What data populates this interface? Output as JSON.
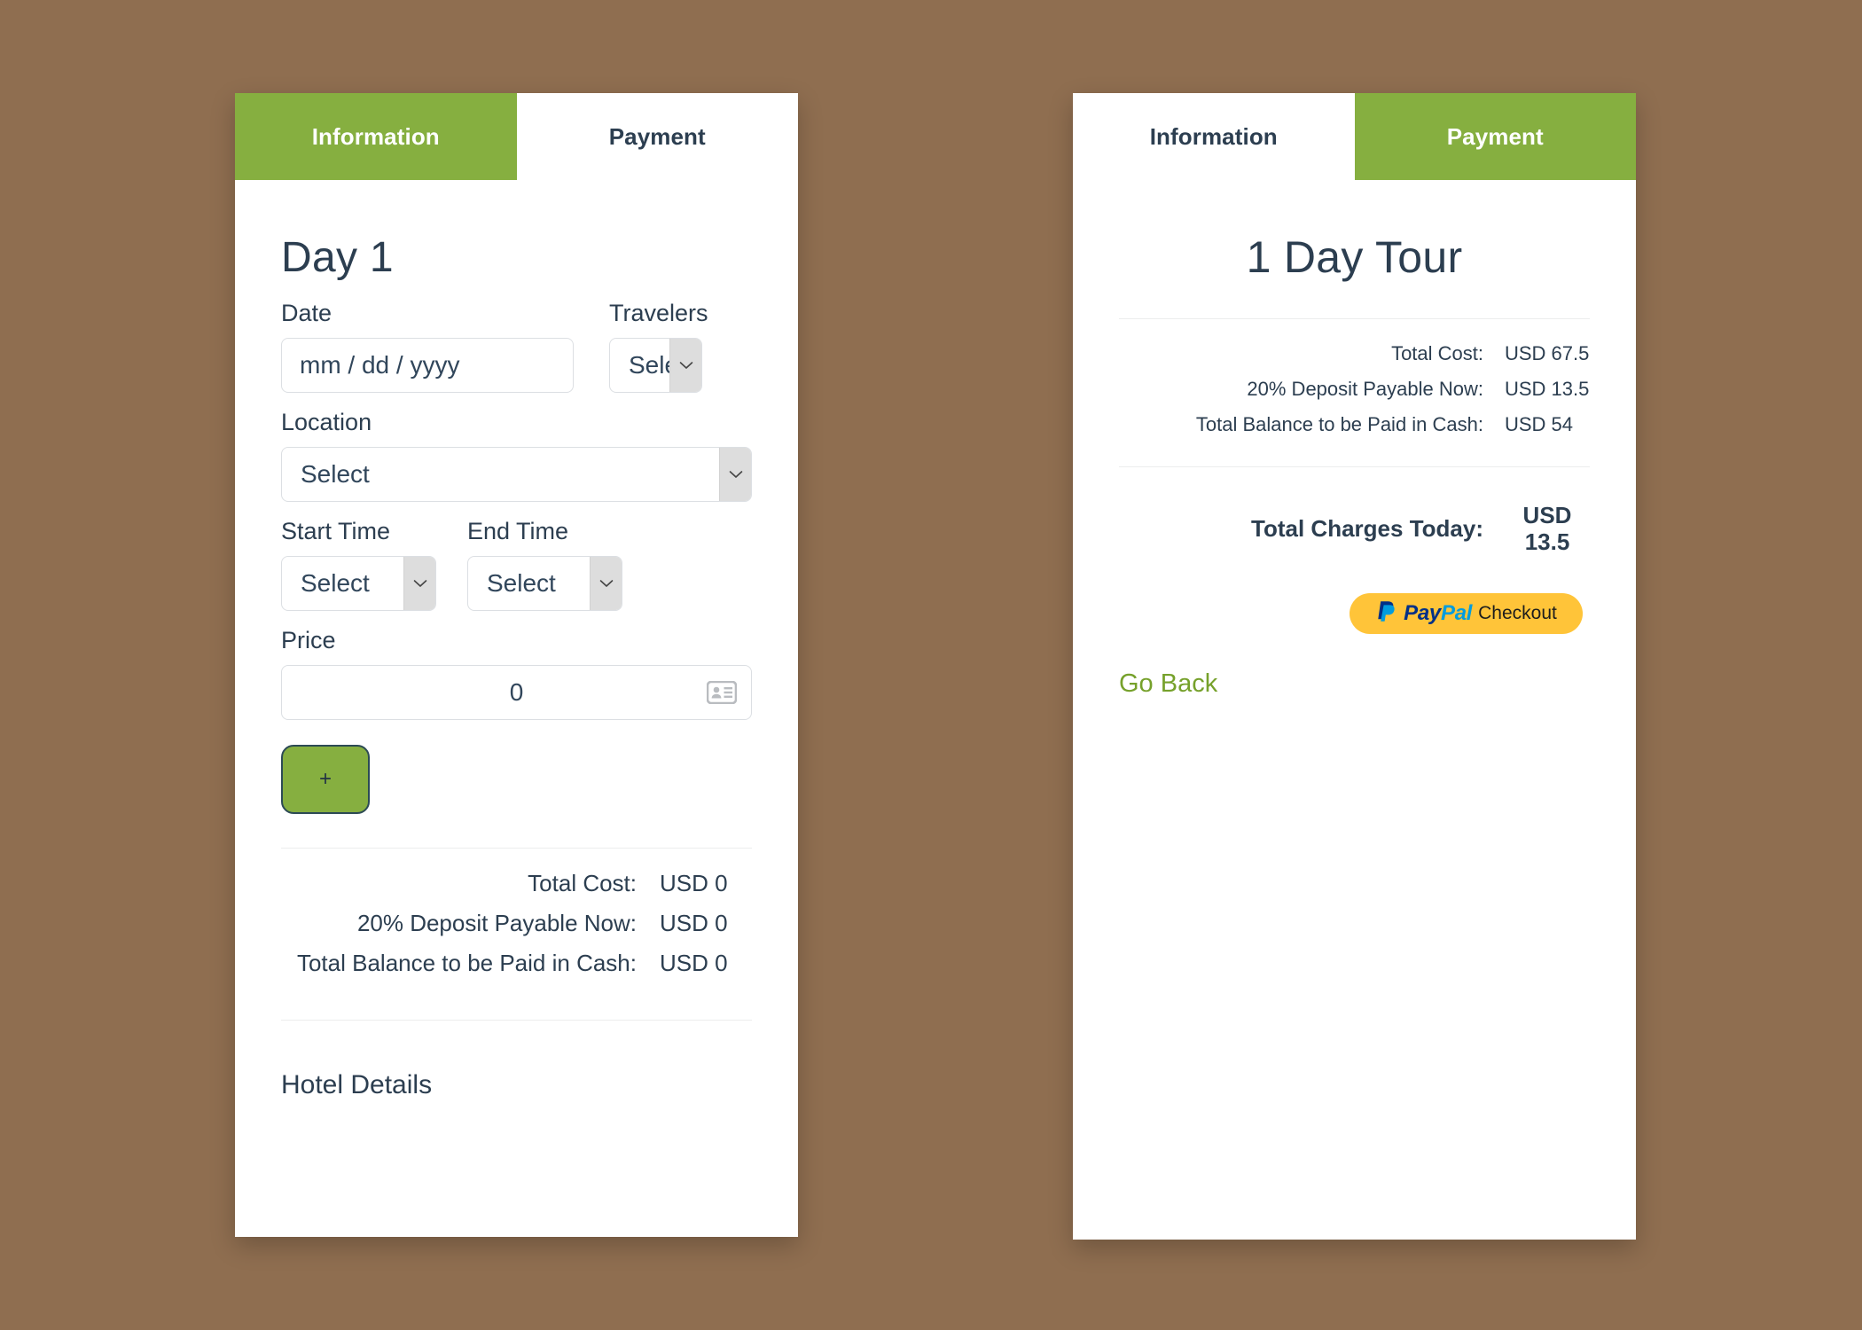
{
  "theme": {
    "background": "#8f6e50",
    "accent_green": "#86af40",
    "link_green": "#76a12b",
    "text_dark": "#2c3e50",
    "paypal_yellow": "#ffc439",
    "paypal_blue_dark": "#003087",
    "paypal_blue_light": "#009cde"
  },
  "left_card": {
    "tabs": [
      {
        "label": "Information",
        "active": true
      },
      {
        "label": "Payment",
        "active": false
      }
    ],
    "day_title": "Day 1",
    "fields": {
      "date": {
        "label": "Date",
        "placeholder": "mm / dd / yyyy",
        "value": ""
      },
      "travelers": {
        "label": "Travelers",
        "value": "Select"
      },
      "location": {
        "label": "Location",
        "value": "Select"
      },
      "start_time": {
        "label": "Start Time",
        "value": "Select"
      },
      "end_time": {
        "label": "End Time",
        "value": "Select"
      },
      "price": {
        "label": "Price",
        "value": "0",
        "icon": "contact-card-autofill-icon"
      }
    },
    "add_button": {
      "label": "+"
    },
    "summary": [
      {
        "label": "Total Cost:",
        "value": "USD 0"
      },
      {
        "label": "20% Deposit Payable Now:",
        "value": "USD 0"
      },
      {
        "label": "Total Balance to be Paid in Cash:",
        "value": "USD 0"
      }
    ],
    "hotel_details_heading": "Hotel Details"
  },
  "right_card": {
    "tabs": [
      {
        "label": "Information",
        "active": false
      },
      {
        "label": "Payment",
        "active": true
      }
    ],
    "tour_title": "1 Day Tour",
    "summary": [
      {
        "label": "Total Cost:",
        "value": "USD 67.5"
      },
      {
        "label": "20% Deposit Payable Now:",
        "value": "USD 13.5"
      },
      {
        "label": "Total Balance to be Paid in Cash:",
        "value": "USD 54"
      }
    ],
    "total": {
      "label": "Total Charges Today:",
      "currency": "USD",
      "amount": "13.5"
    },
    "paypal": {
      "logo_glyph": "P",
      "word_pay": "Pay",
      "word_pal": "Pal",
      "checkout": "Checkout"
    },
    "go_back": "Go Back"
  }
}
